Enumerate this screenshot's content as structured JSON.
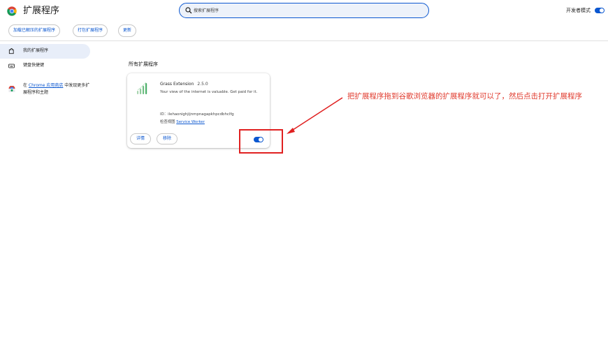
{
  "header": {
    "title": "扩展程序",
    "search_placeholder": "搜索扩展程序",
    "developer_mode_label": "开发者模式",
    "developer_mode_on": true
  },
  "toolbar": {
    "load_unpacked": "加载已解压的扩展程序",
    "pack_extension": "打包扩展程序",
    "update": "更新"
  },
  "sidebar": {
    "items": [
      {
        "label": "我的扩展程序",
        "icon": "extension-icon",
        "active": true
      },
      {
        "label": "键盘快捷键",
        "icon": "keyboard-icon",
        "active": false
      }
    ],
    "store": {
      "prefix": "在 ",
      "link": "Chrome 应用商店",
      "suffix": " 中发现更多扩展程序和主题"
    }
  },
  "main": {
    "section_title": "所有扩展程序",
    "extension": {
      "name": "Grass Extension",
      "version": "2.5.0",
      "description": "Your view of the internet is valuable. Get paid for it.",
      "id_label": "ID：",
      "id": "ilehaonighjijnmpnagapkhpcdbhclfg",
      "views_label": "检查视图 ",
      "service_worker": "Service Worker",
      "details_button": "详情",
      "remove_button": "移除",
      "enabled": true
    }
  },
  "annotation": {
    "text": "把扩展程序拖到谷歌浏览器的扩展程序就可以了，然后点击打开扩展程序",
    "color": "#e03a2d"
  },
  "colors": {
    "accent": "#0b57d0",
    "sidebar_active_bg": "#e8eef9",
    "search_bg": "#edf2fa",
    "annotation_red": "#e02020"
  }
}
